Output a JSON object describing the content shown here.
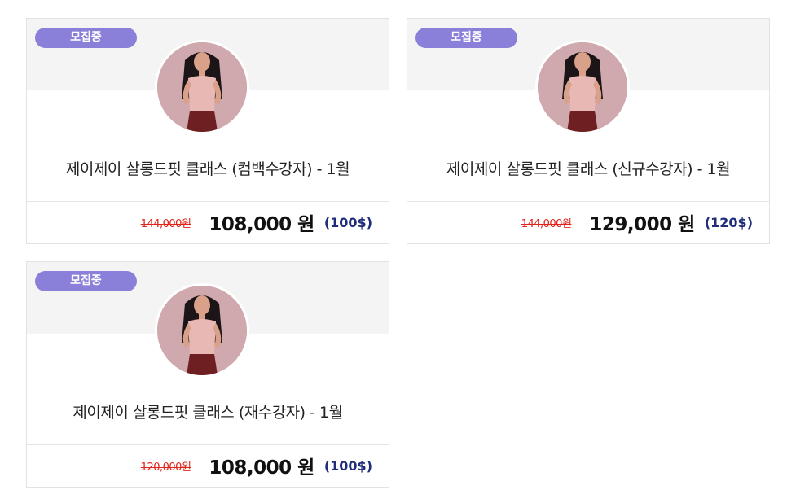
{
  "colors": {
    "badge_bg": "#8b80d9",
    "old_price": "#e2231a",
    "usd_price": "#1f2d7a",
    "card_top_bg": "#f4f4f4"
  },
  "cards": [
    {
      "badge": "모집중",
      "avatar_icon": "instructor-photo",
      "title": "제이제이 살롱드핏 클래스 (컴백수강자) - 1월",
      "old_price": "144,000원",
      "price": "108,000 원",
      "usd_price": "(100$)"
    },
    {
      "badge": "모집중",
      "avatar_icon": "instructor-photo",
      "title": "제이제이 살롱드핏 클래스 (신규수강자) - 1월",
      "old_price": "144,000원",
      "price": "129,000 원",
      "usd_price": "(120$)"
    },
    {
      "badge": "모집중",
      "avatar_icon": "instructor-photo",
      "title": "제이제이 살롱드핏 클래스 (재수강자) - 1월",
      "old_price": "120,000원",
      "price": "108,000 원",
      "usd_price": "(100$)"
    }
  ]
}
